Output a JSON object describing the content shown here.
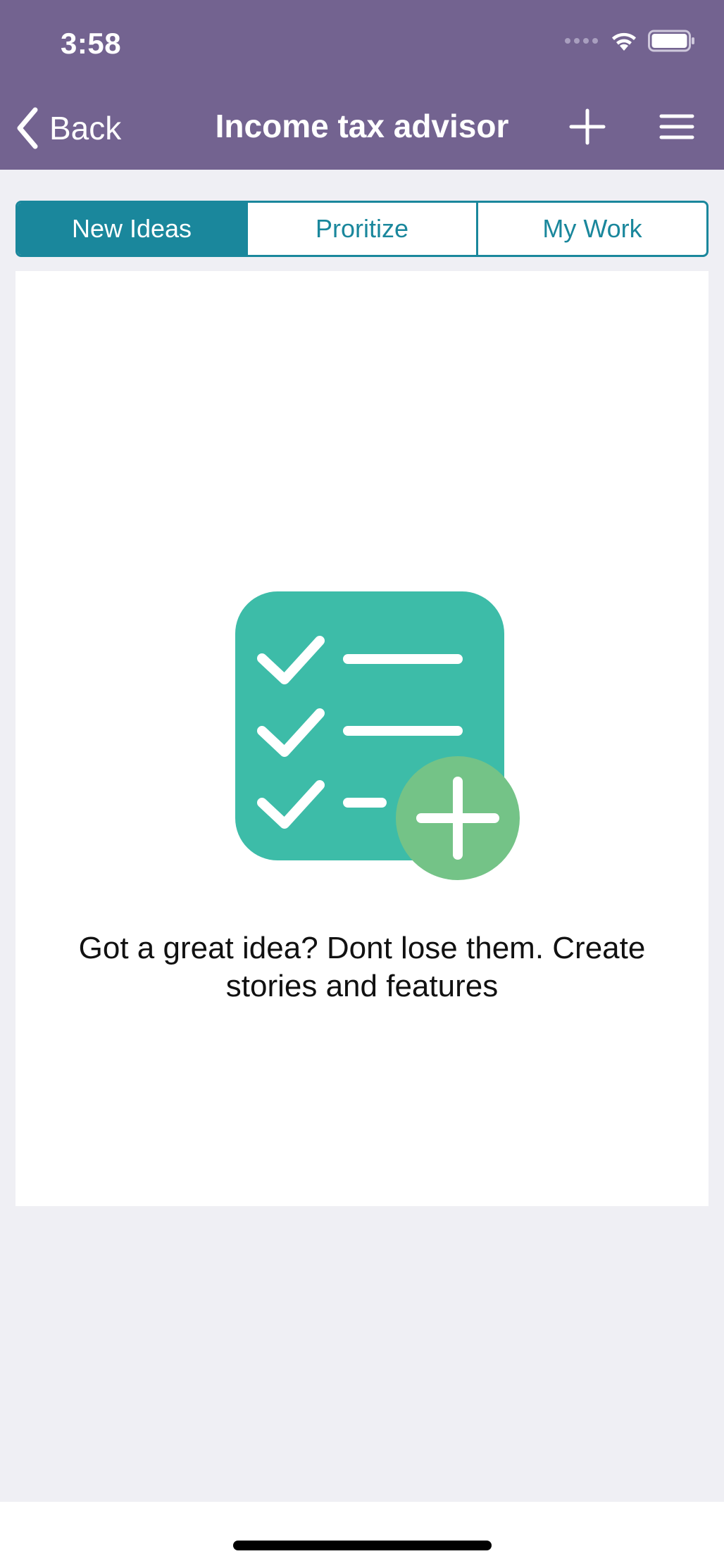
{
  "status_bar": {
    "time": "3:58"
  },
  "nav": {
    "back_label": "Back",
    "title": "Income tax advisor"
  },
  "tabs": [
    {
      "label": "New Ideas",
      "active": true
    },
    {
      "label": "Proritize",
      "active": false
    },
    {
      "label": "My Work",
      "active": false
    }
  ],
  "empty_state": {
    "message": "Got a great idea? Dont lose them. Create stories and features",
    "icon": "checklist-add-icon"
  },
  "colors": {
    "nav_bar": "#736390",
    "accent": "#1a879c",
    "illustration_primary": "#3dbca8",
    "illustration_badge": "#74c387",
    "background": "#efeff4"
  }
}
